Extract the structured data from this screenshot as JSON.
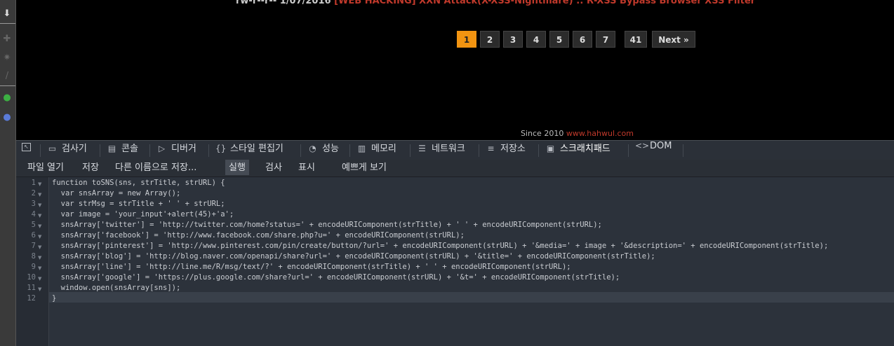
{
  "page": {
    "headline_prefix": "rw-r--r-- 1/07/2016",
    "headline_link": "[WEB HACKING] XXN Attack(X-XSS-Nightmare) :: R-XSS Bypass Browser XSS Filter",
    "pagination": [
      "1",
      "2",
      "3",
      "4",
      "5",
      "6",
      "7",
      "41",
      "Next »"
    ],
    "active_page": "1",
    "footer_since": "Since 2010",
    "footer_link": "www.hahwul.com",
    "accent_color": "#f29411",
    "link_color": "#c0392b"
  },
  "devtools": {
    "tabs": [
      {
        "label": "",
        "icon": "inspect-icon"
      },
      {
        "label": "검사기",
        "icon": "inspector-icon"
      },
      {
        "label": "콘솔",
        "icon": "console-icon"
      },
      {
        "label": "디버거",
        "icon": "debugger-icon"
      },
      {
        "label": "스타일 편집기",
        "icon": "style-editor-icon"
      },
      {
        "label": "성능",
        "icon": "performance-icon"
      },
      {
        "label": "메모리",
        "icon": "memory-icon"
      },
      {
        "label": "네트워크",
        "icon": "network-icon"
      },
      {
        "label": "저장소",
        "icon": "storage-icon"
      },
      {
        "label": "스크래치패드",
        "icon": "scratchpad-icon"
      },
      {
        "label": "DOM",
        "icon": "dom-icon"
      }
    ],
    "selected_tab": "스크래치패드",
    "toolbar": {
      "open_file": "파일 열기",
      "save": "저장",
      "save_as": "다른 이름으로 저장...",
      "run": "실행",
      "inspect": "검사",
      "display": "표시",
      "pretty_print": "예쁘게 보기"
    },
    "line_numbers": [
      "1",
      "2",
      "3",
      "4",
      "5",
      "6",
      "7",
      "8",
      "9",
      "10",
      "11",
      "12"
    ],
    "code_lines": [
      "function toSNS(sns, strTitle, strURL) {",
      "  var snsArray = new Array();",
      "  var strMsg = strTitle + ' ' + strURL;",
      "  var image = 'your_input'+alert(45)+'a';",
      "  snsArray['twitter'] = 'http://twitter.com/home?status=' + encodeURIComponent(strTitle) + ' ' + encodeURIComponent(strURL);",
      "  snsArray['facebook'] = 'http://www.facebook.com/share.php?u=' + encodeURIComponent(strURL);",
      "  snsArray['pinterest'] = 'http://www.pinterest.com/pin/create/button/?url=' + encodeURIComponent(strURL) + '&media=' + image + '&description=' + encodeURIComponent(strTitle);",
      "  snsArray['blog'] = 'http://blog.naver.com/openapi/share?url=' + encodeURIComponent(strURL) + '&title=' + encodeURIComponent(strTitle);",
      "  snsArray['line'] = 'http://line.me/R/msg/text/?' + encodeURIComponent(strTitle) + ' ' + encodeURIComponent(strURL);",
      "  snsArray['google'] = 'https://plus.google.com/share?url=' + encodeURIComponent(strURL) + '&t=' + encodeURIComponent(strTitle);",
      "  window.open(snsArray[sns]);",
      "}"
    ]
  }
}
